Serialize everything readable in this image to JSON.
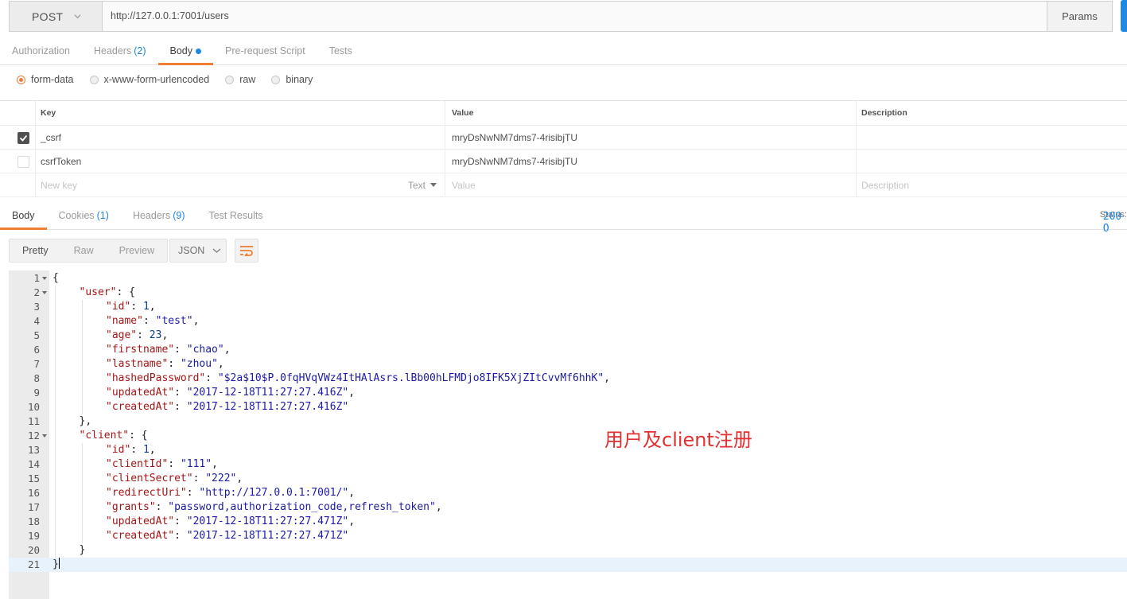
{
  "request": {
    "method": "POST",
    "url": "http://127.0.0.1:7001/users",
    "params_label": "Params"
  },
  "request_tabs": [
    {
      "label": "Authorization"
    },
    {
      "label": "Headers",
      "count": "(2)"
    },
    {
      "label": "Body",
      "active": true
    },
    {
      "label": "Pre-request Script"
    },
    {
      "label": "Tests"
    }
  ],
  "body_types": [
    "form-data",
    "x-www-form-urlencoded",
    "raw",
    "binary"
  ],
  "form_table": {
    "headers": {
      "key": "Key",
      "value": "Value",
      "description": "Description"
    },
    "rows": [
      {
        "checked": true,
        "key": "_csrf",
        "value": "mryDsNwNM7dms7-4risibjTU"
      },
      {
        "checked": false,
        "key": "csrfToken",
        "value": "mryDsNwNM7dms7-4risibjTU"
      }
    ],
    "new_row": {
      "key_placeholder": "New key",
      "type": "Text",
      "value_placeholder": "Value",
      "description_placeholder": "Description"
    }
  },
  "response_tabs": [
    {
      "label": "Body",
      "active": true
    },
    {
      "label": "Cookies",
      "count": "(1)"
    },
    {
      "label": "Headers",
      "count": "(9)"
    },
    {
      "label": "Test Results"
    }
  ],
  "status": {
    "label": "Status:",
    "value": "200 O"
  },
  "view_modes": [
    "Pretty",
    "Raw",
    "Preview"
  ],
  "format": "JSON",
  "code_lines": [
    {
      "n": "1",
      "fold": true,
      "indent": 0,
      "tokens": [
        [
          "p",
          "{"
        ]
      ]
    },
    {
      "n": "2",
      "fold": true,
      "indent": 1,
      "tokens": [
        [
          "k",
          "\"user\""
        ],
        [
          "p",
          ": {"
        ]
      ]
    },
    {
      "n": "3",
      "indent": 2,
      "tokens": [
        [
          "k",
          "\"id\""
        ],
        [
          "p",
          ": "
        ],
        [
          "n",
          "1"
        ],
        [
          "p",
          ","
        ]
      ]
    },
    {
      "n": "4",
      "indent": 2,
      "tokens": [
        [
          "k",
          "\"name\""
        ],
        [
          "p",
          ": "
        ],
        [
          "s",
          "\"test\""
        ],
        [
          "p",
          ","
        ]
      ]
    },
    {
      "n": "5",
      "indent": 2,
      "tokens": [
        [
          "k",
          "\"age\""
        ],
        [
          "p",
          ": "
        ],
        [
          "n",
          "23"
        ],
        [
          "p",
          ","
        ]
      ]
    },
    {
      "n": "6",
      "indent": 2,
      "tokens": [
        [
          "k",
          "\"firstname\""
        ],
        [
          "p",
          ": "
        ],
        [
          "s",
          "\"chao\""
        ],
        [
          "p",
          ","
        ]
      ]
    },
    {
      "n": "7",
      "indent": 2,
      "tokens": [
        [
          "k",
          "\"lastname\""
        ],
        [
          "p",
          ": "
        ],
        [
          "s",
          "\"zhou\""
        ],
        [
          "p",
          ","
        ]
      ]
    },
    {
      "n": "8",
      "indent": 2,
      "tokens": [
        [
          "k",
          "\"hashedPassword\""
        ],
        [
          "p",
          ": "
        ],
        [
          "s",
          "\"$2a$10$P.0fqHVqVWz4ItHAlAsrs.lBb00hLFMDjo8IFK5XjZItCvvMf6hhK\""
        ],
        [
          "p",
          ","
        ]
      ]
    },
    {
      "n": "9",
      "indent": 2,
      "tokens": [
        [
          "k",
          "\"updatedAt\""
        ],
        [
          "p",
          ": "
        ],
        [
          "s",
          "\"2017-12-18T11:27:27.416Z\""
        ],
        [
          "p",
          ","
        ]
      ]
    },
    {
      "n": "10",
      "indent": 2,
      "tokens": [
        [
          "k",
          "\"createdAt\""
        ],
        [
          "p",
          ": "
        ],
        [
          "s",
          "\"2017-12-18T11:27:27.416Z\""
        ]
      ]
    },
    {
      "n": "11",
      "indent": 1,
      "tokens": [
        [
          "p",
          "},"
        ]
      ]
    },
    {
      "n": "12",
      "fold": true,
      "indent": 1,
      "tokens": [
        [
          "k",
          "\"client\""
        ],
        [
          "p",
          ": {"
        ]
      ]
    },
    {
      "n": "13",
      "indent": 2,
      "tokens": [
        [
          "k",
          "\"id\""
        ],
        [
          "p",
          ": "
        ],
        [
          "n",
          "1"
        ],
        [
          "p",
          ","
        ]
      ]
    },
    {
      "n": "14",
      "indent": 2,
      "tokens": [
        [
          "k",
          "\"clientId\""
        ],
        [
          "p",
          ": "
        ],
        [
          "s",
          "\"111\""
        ],
        [
          "p",
          ","
        ]
      ]
    },
    {
      "n": "15",
      "indent": 2,
      "tokens": [
        [
          "k",
          "\"clientSecret\""
        ],
        [
          "p",
          ": "
        ],
        [
          "s",
          "\"222\""
        ],
        [
          "p",
          ","
        ]
      ]
    },
    {
      "n": "16",
      "indent": 2,
      "tokens": [
        [
          "k",
          "\"redirectUri\""
        ],
        [
          "p",
          ": "
        ],
        [
          "s",
          "\"http://127.0.0.1:7001/\""
        ],
        [
          "p",
          ","
        ]
      ]
    },
    {
      "n": "17",
      "indent": 2,
      "tokens": [
        [
          "k",
          "\"grants\""
        ],
        [
          "p",
          ": "
        ],
        [
          "s",
          "\"password,authorization_code,refresh_token\""
        ],
        [
          "p",
          ","
        ]
      ]
    },
    {
      "n": "18",
      "indent": 2,
      "tokens": [
        [
          "k",
          "\"updatedAt\""
        ],
        [
          "p",
          ": "
        ],
        [
          "s",
          "\"2017-12-18T11:27:27.471Z\""
        ],
        [
          "p",
          ","
        ]
      ]
    },
    {
      "n": "19",
      "indent": 2,
      "tokens": [
        [
          "k",
          "\"createdAt\""
        ],
        [
          "p",
          ": "
        ],
        [
          "s",
          "\"2017-12-18T11:27:27.471Z\""
        ]
      ]
    },
    {
      "n": "20",
      "indent": 1,
      "tokens": [
        [
          "p",
          "}"
        ]
      ]
    },
    {
      "n": "21",
      "indent": 0,
      "current": true,
      "tokens": [
        [
          "p",
          "}"
        ]
      ]
    }
  ],
  "annotation": "用户及client注册",
  "colors": {
    "accent": "#f07d34",
    "link": "#1e88e5",
    "json_key": "#a31515",
    "json_string": "#1a1aa6",
    "annotation": "#e03030"
  },
  "icons": [
    "chevron-down-icon",
    "checkmark-icon",
    "caret-down-icon",
    "wrap-lines-icon"
  ]
}
